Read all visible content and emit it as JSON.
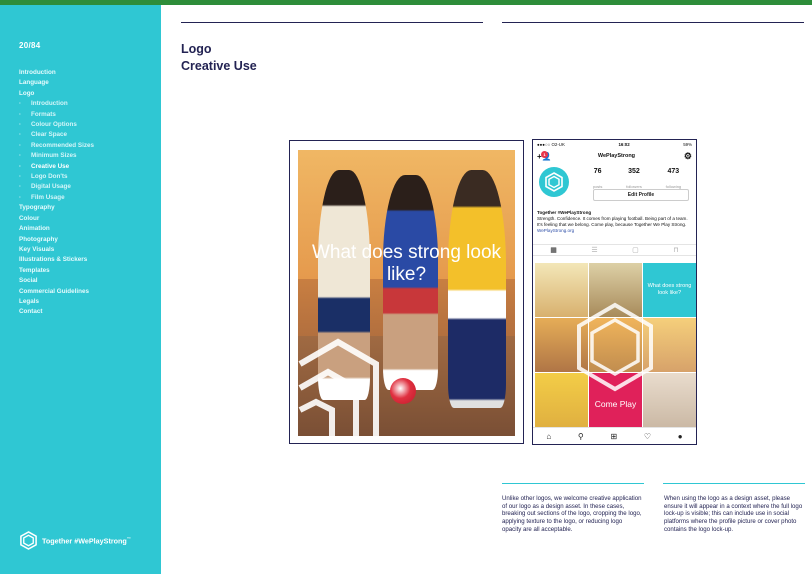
{
  "page": {
    "number": "20/84"
  },
  "nav": {
    "items": [
      {
        "label": "Introduction",
        "sub": false,
        "active": false
      },
      {
        "label": "Language",
        "sub": false,
        "active": false
      },
      {
        "label": "Logo",
        "sub": false,
        "active": false
      },
      {
        "label": "Introduction",
        "sub": true,
        "active": false
      },
      {
        "label": "Formats",
        "sub": true,
        "active": false
      },
      {
        "label": "Colour Options",
        "sub": true,
        "active": false
      },
      {
        "label": "Clear Space",
        "sub": true,
        "active": false
      },
      {
        "label": "Recommended Sizes",
        "sub": true,
        "active": false
      },
      {
        "label": "Minimum Sizes",
        "sub": true,
        "active": false
      },
      {
        "label": "Creative Use",
        "sub": true,
        "active": true
      },
      {
        "label": "Logo Don'ts",
        "sub": true,
        "active": false
      },
      {
        "label": "Digital Usage",
        "sub": true,
        "active": false
      },
      {
        "label": "Film Usage",
        "sub": true,
        "active": false
      },
      {
        "label": "Typography",
        "sub": false,
        "active": false
      },
      {
        "label": "Colour",
        "sub": false,
        "active": false
      },
      {
        "label": "Animation",
        "sub": false,
        "active": false
      },
      {
        "label": "Photography",
        "sub": false,
        "active": false
      },
      {
        "label": "Key Visuals",
        "sub": false,
        "active": false
      },
      {
        "label": "Illustrations & Stickers",
        "sub": false,
        "active": false
      },
      {
        "label": "Templates",
        "sub": false,
        "active": false
      },
      {
        "label": "Social",
        "sub": false,
        "active": false
      },
      {
        "label": "Commercial Guidelines",
        "sub": false,
        "active": false
      },
      {
        "label": "Legals",
        "sub": false,
        "active": false
      },
      {
        "label": "Contact",
        "sub": false,
        "active": false
      }
    ]
  },
  "brand": {
    "tagline": "Together #WePlayStrong",
    "trademark": "™"
  },
  "heading": {
    "title": "Logo",
    "subtitle": "Creative Use"
  },
  "poster": {
    "overlay": "What does strong look like?"
  },
  "phone": {
    "status": {
      "carrier": "●●●○○ O2-UK",
      "time": "16:02",
      "battery": "59%"
    },
    "account": "WePlayStrong",
    "notification_count": "1",
    "stats": [
      {
        "value": "76",
        "label": "posts"
      },
      {
        "value": "352",
        "label": "followers"
      },
      {
        "value": "473",
        "label": "following"
      }
    ],
    "edit_label": "Edit Profile",
    "bio_name": "Together #WePlayStrong",
    "bio_text": "Strength. Confidence. It comes from playing football. Being part of a team. It's feeling that we belong. Come play, because Together We Play Strong.",
    "bio_link": "WePlayStrong.org",
    "tile_text": "What does strong look like?",
    "tile_cta": "Come Play"
  },
  "notes": {
    "left": "Unlike other logos, we welcome creative application of our logo as a design asset. In these cases, breaking out sections of the logo, cropping the logo, applying texture to the logo, or reducing logo opacity are all acceptable.",
    "right": "When using the logo as a design asset, please ensure it will appear in a context where the full logo lock-up is visible; this can include use in social platforms where the profile picture or cover photo contains the logo lock-up."
  },
  "colors": {
    "sidebar": "#2fc7d3",
    "topbar": "#2e8d3a",
    "ink": "#232353",
    "accent_pink": "#e0215a"
  }
}
